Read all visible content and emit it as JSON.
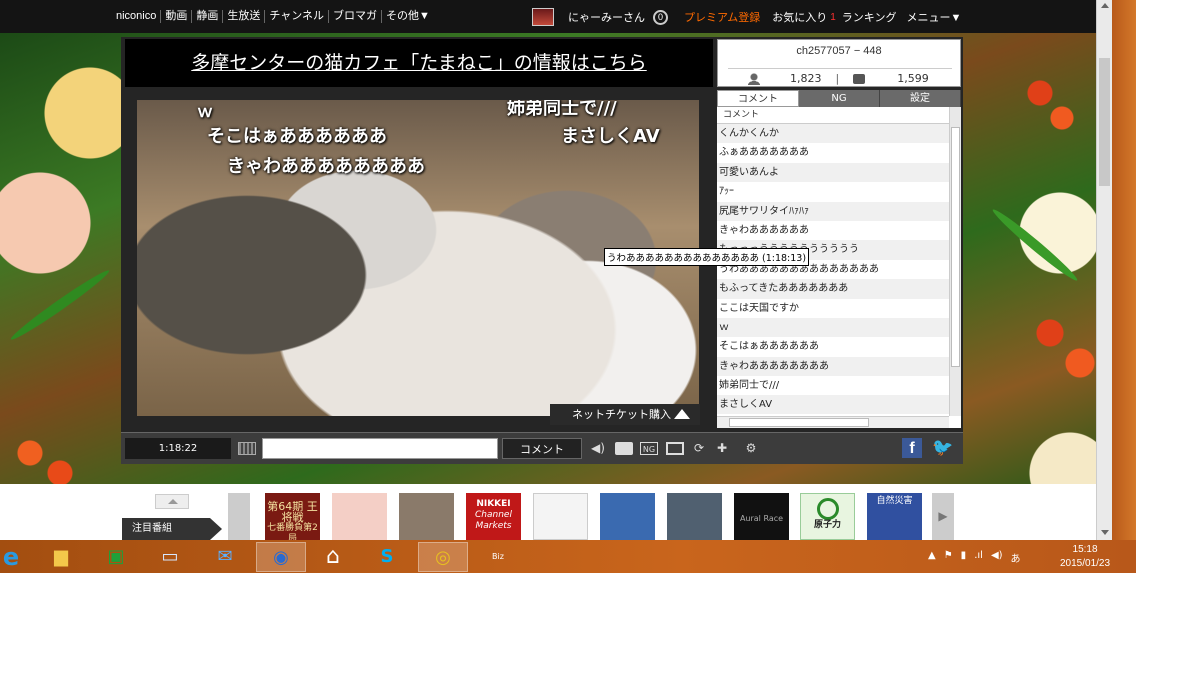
{
  "topbar": {
    "nav": [
      "niconico",
      "動画",
      "静画",
      "生放送",
      "チャンネル",
      "ブロマガ",
      "その他▼"
    ],
    "username": "にゃーみーさん",
    "points": "0",
    "premium": "プレミアム登録",
    "favorites": "お気に入り",
    "favorites_count": "1",
    "ranking": "ランキング",
    "menu": "メニュー▼"
  },
  "banner": "多摩センターの猫カフェ「たまねこ」の情報はこちら",
  "channel_info": {
    "id": "ch2577057 − 448",
    "viewers": "1,823",
    "comments": "1,599"
  },
  "comment_tabs": [
    "コメント",
    "NG",
    "設定"
  ],
  "comment_header": "コメント",
  "comments": [
    "くんかくんか",
    "ふぁあああああああ",
    "可愛いあんよ",
    "ｱｯｰ",
    "尻尾サワリタイﾊｧﾊｧ",
    "きゃわああああああ",
    "もっっっうううううううううう",
    "うわああああああああああああああ",
    "もふってきたあああああああ",
    "ここは天国ですか",
    "ｗ",
    "そこはぁああああああ",
    "きゃわああああああああ",
    "姉弟同士で///",
    "まさしくAV"
  ],
  "tooltip": "うわああああああああああああああ (1:18:13)",
  "danmaku": [
    "ｗ",
    "そこはぁああああああ",
    "きゃわああああああああ",
    "姉弟同士で///",
    "まさしくAV"
  ],
  "ticket": "ネットチケット購入",
  "controls": {
    "time": "1:18:22",
    "comment_button": "コメント",
    "comment_input_placeholder": ""
  },
  "featured": "注目番組",
  "thumbnails": [
    {
      "title": "第64期 王将戦",
      "sub": "七番勝負第2局",
      "color": "#7a1a12"
    },
    {
      "title": "",
      "sub": "",
      "color": "#f4cfc6"
    },
    {
      "title": "",
      "sub": "",
      "color": "#8a7a6a"
    },
    {
      "title": "NIKKEI",
      "sub": "Channel Markets",
      "color": "#c01818"
    },
    {
      "title": "",
      "sub": "",
      "color": "#f4f4f4"
    },
    {
      "title": "",
      "sub": "",
      "color": "#3a6ab0"
    },
    {
      "title": "",
      "sub": "",
      "color": "#506070"
    },
    {
      "title": "Aural Race",
      "sub": "",
      "color": "#111111"
    },
    {
      "title": "原子力",
      "sub": "",
      "color": "#e8f5e0"
    },
    {
      "title": "自然災害",
      "sub": "",
      "color": "#3050a0"
    }
  ],
  "taskbar": {
    "icons": [
      "ie-icon",
      "file-explorer-icon",
      "store-icon",
      "lenovo-icon",
      "mail-icon",
      "thunderbird-icon",
      "home-icon",
      "skype-icon",
      "chrome-icon",
      "bizsoft-icon"
    ],
    "tray_ime": "あ",
    "time": "15:18",
    "date": "2015/01/23"
  }
}
